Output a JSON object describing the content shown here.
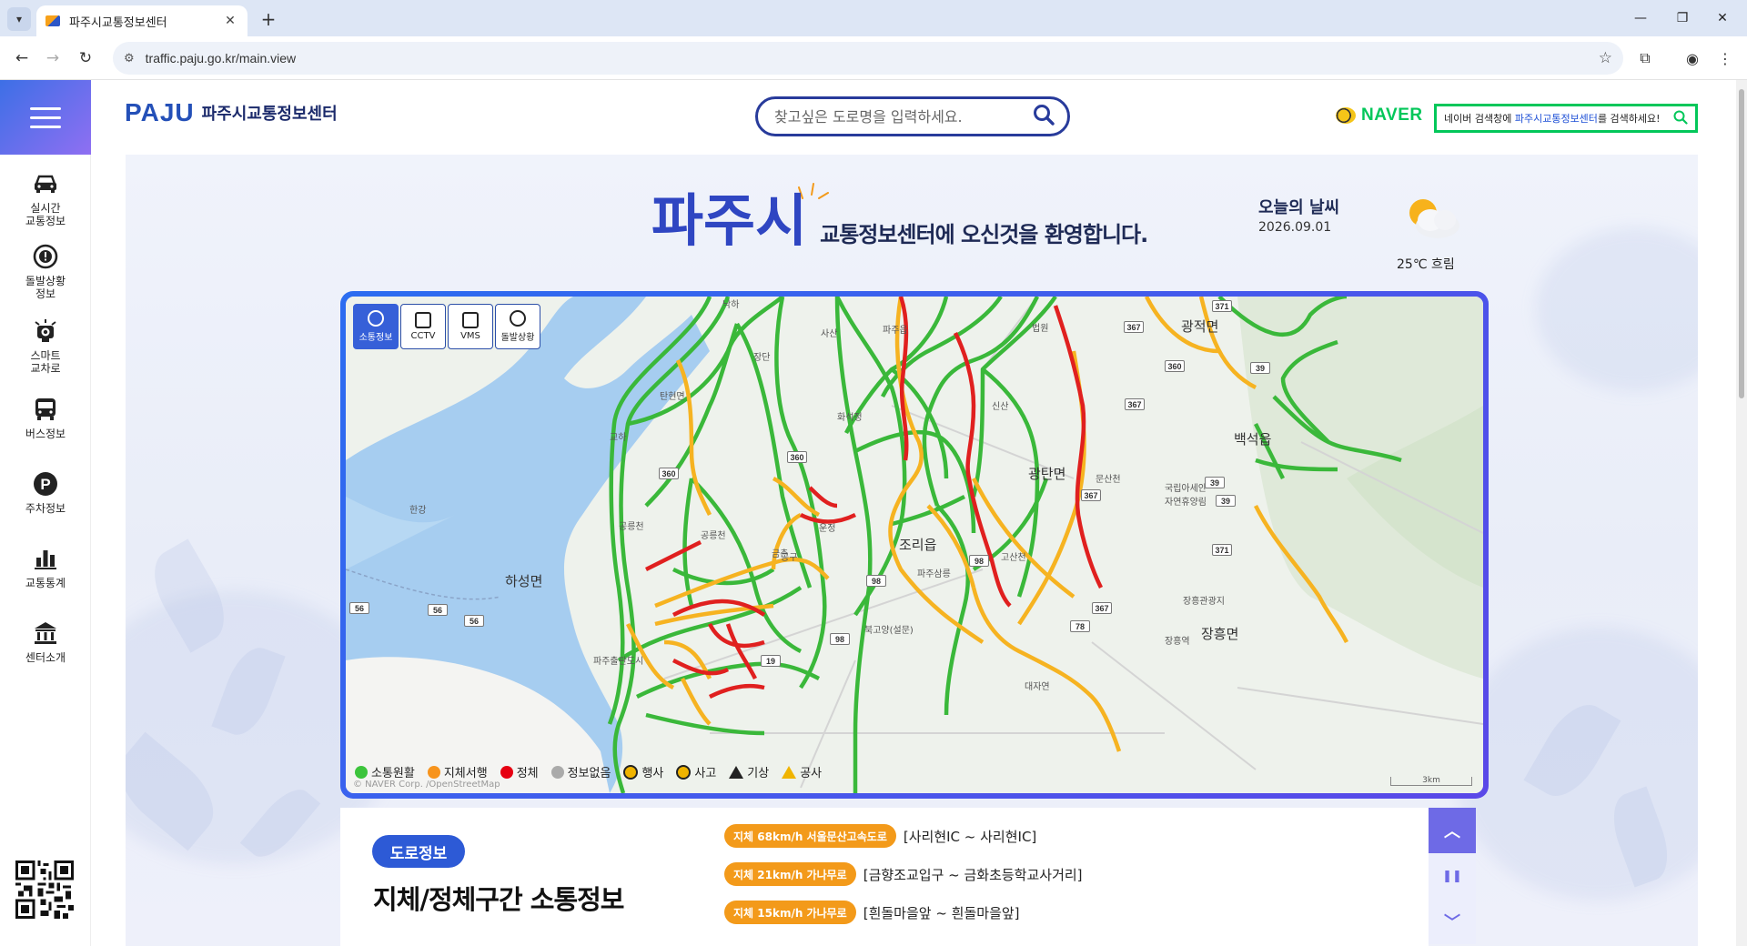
{
  "browser": {
    "tab_title": "파주시교통정보센터",
    "tab_close": "✕",
    "new_tab": "+",
    "url": "traffic.paju.go.kr/main.view"
  },
  "header": {
    "logo_text": "PAJU",
    "site_name": "파주시교통정보센터",
    "search_placeholder": "찾고싶은 도로명을 입력하세요.",
    "naver_word": "NAVER",
    "naver_prefix": "네이버 검색창에 ",
    "naver_highlight": "파주시교통정보센터",
    "naver_suffix": "를 검색하세요!"
  },
  "sidebar": {
    "items": [
      {
        "label": "실시간\n교통정보",
        "icon": "car-icon"
      },
      {
        "label": "돌발상황\n정보",
        "icon": "alert-icon"
      },
      {
        "label": "스마트\n교차로",
        "icon": "smart-cross-icon"
      },
      {
        "label": "버스정보",
        "icon": "bus-icon"
      },
      {
        "label": "주차정보",
        "icon": "parking-icon"
      },
      {
        "label": "교통통계",
        "icon": "chart-icon"
      },
      {
        "label": "센터소개",
        "icon": "building-icon"
      }
    ]
  },
  "hero": {
    "title_big": "파주시",
    "title_rest": "교통정보센터에 오신것을 환영합니다.",
    "weather_title": "오늘의 날씨",
    "weather_date": "2026.09.01",
    "weather_temp": "25℃ 흐림",
    "weather_icon": "partly-cloudy-icon"
  },
  "map": {
    "tools": [
      {
        "label": "소통정보",
        "active": true
      },
      {
        "label": "CCTV",
        "active": false
      },
      {
        "label": "VMS",
        "active": false
      },
      {
        "label": "돌발상황",
        "active": false
      }
    ],
    "legend": [
      {
        "label": "소통원활",
        "color": "#3cc43c"
      },
      {
        "label": "지체서행",
        "color": "#f7941d"
      },
      {
        "label": "정체",
        "color": "#e60012"
      },
      {
        "label": "정보없음",
        "color": "#aaaaaa"
      },
      {
        "label": "행사"
      },
      {
        "label": "사고"
      },
      {
        "label": "기상"
      },
      {
        "label": "공사"
      }
    ],
    "copyright": "© NAVER Corp. /OpenStreetMap",
    "scale": "3km",
    "labels": {
      "hansong": "하성면",
      "gwangtan": "광탄면",
      "jori": "조리읍",
      "gwangjeok": "광적면",
      "baekseok": "백석읍",
      "janghung": "장흥면",
      "hangang": "한강",
      "tanhyeon": "탄현면",
      "paju_city": "파주출판도시",
      "munsan": "문산천",
      "gongneung": "공릉천",
      "gongneung2": "공릉천",
      "parksan": "파주삼릉",
      "bukhan": "북고양(설문)",
      "gosan": "고산천",
      "janghung_st": "장흥역",
      "arboretum": "국립아세안\n자연휴양림",
      "jangheung_tour": "장흥관광지",
      "pajusamgol": "파주읍",
      "beopwon": "법원",
      "gyoha": "교하",
      "geumchon": "금촌",
      "unjeong": "운정",
      "daejaon": "대자연",
      "seoulsan": "사산",
      "naksan": "낙하",
      "hwaseok": "화석정",
      "jangdan": "장단",
      "sinsan": "신산",
      "gonggu": "공구"
    }
  },
  "road_info": {
    "badge": "도로정보",
    "heading": "지체/정체구간 소통정보",
    "rows": [
      {
        "pill": "지체 68km/h 서울문산고속도로",
        "section": "[사리현IC ~ 사리현IC]"
      },
      {
        "pill": "지체 21km/h 가나무로",
        "section": "[금향조교입구 ~ 금화초등학교사거리]"
      },
      {
        "pill": "지체 15km/h 가나무로",
        "section": "[흰돌마을앞 ~ 흰돌마을앞]"
      }
    ],
    "arrow_up": "︿",
    "arrow_pause": "❚❚",
    "arrow_down": "﹀"
  }
}
